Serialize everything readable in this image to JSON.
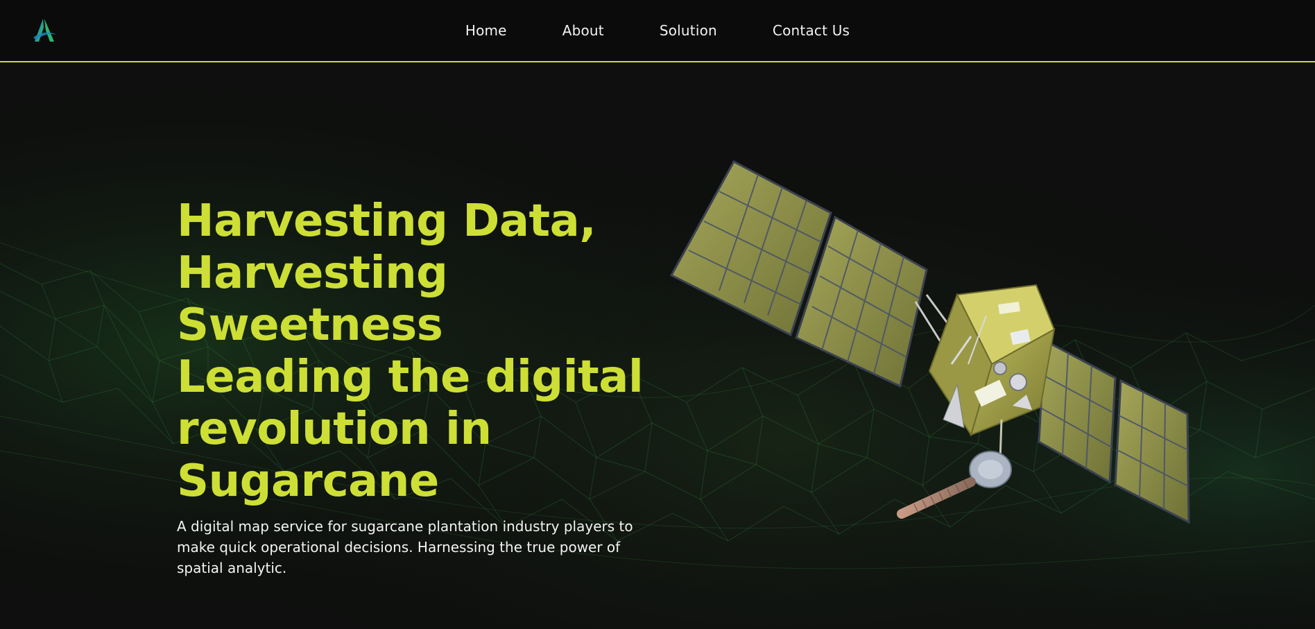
{
  "nav": {
    "logo_icon": "brand-logo-a-icon",
    "links": [
      "Home",
      "About",
      "Solution",
      "Contact Us"
    ]
  },
  "hero": {
    "title_lines": [
      "Harvesting Data,",
      "Harvesting",
      "Sweetness",
      "Leading the digital",
      "revolution in",
      "Sugarcane"
    ],
    "description": "A digital map service for sugarcane plantation industry players to make quick operational decisions. Harnessing the true power of spatial analytic.",
    "image": "satellite-illustration"
  },
  "colors": {
    "background": "#0e0f0e",
    "accent": "#cddf35",
    "text": "#f2f2f2",
    "mesh": "#2f7a3a"
  }
}
